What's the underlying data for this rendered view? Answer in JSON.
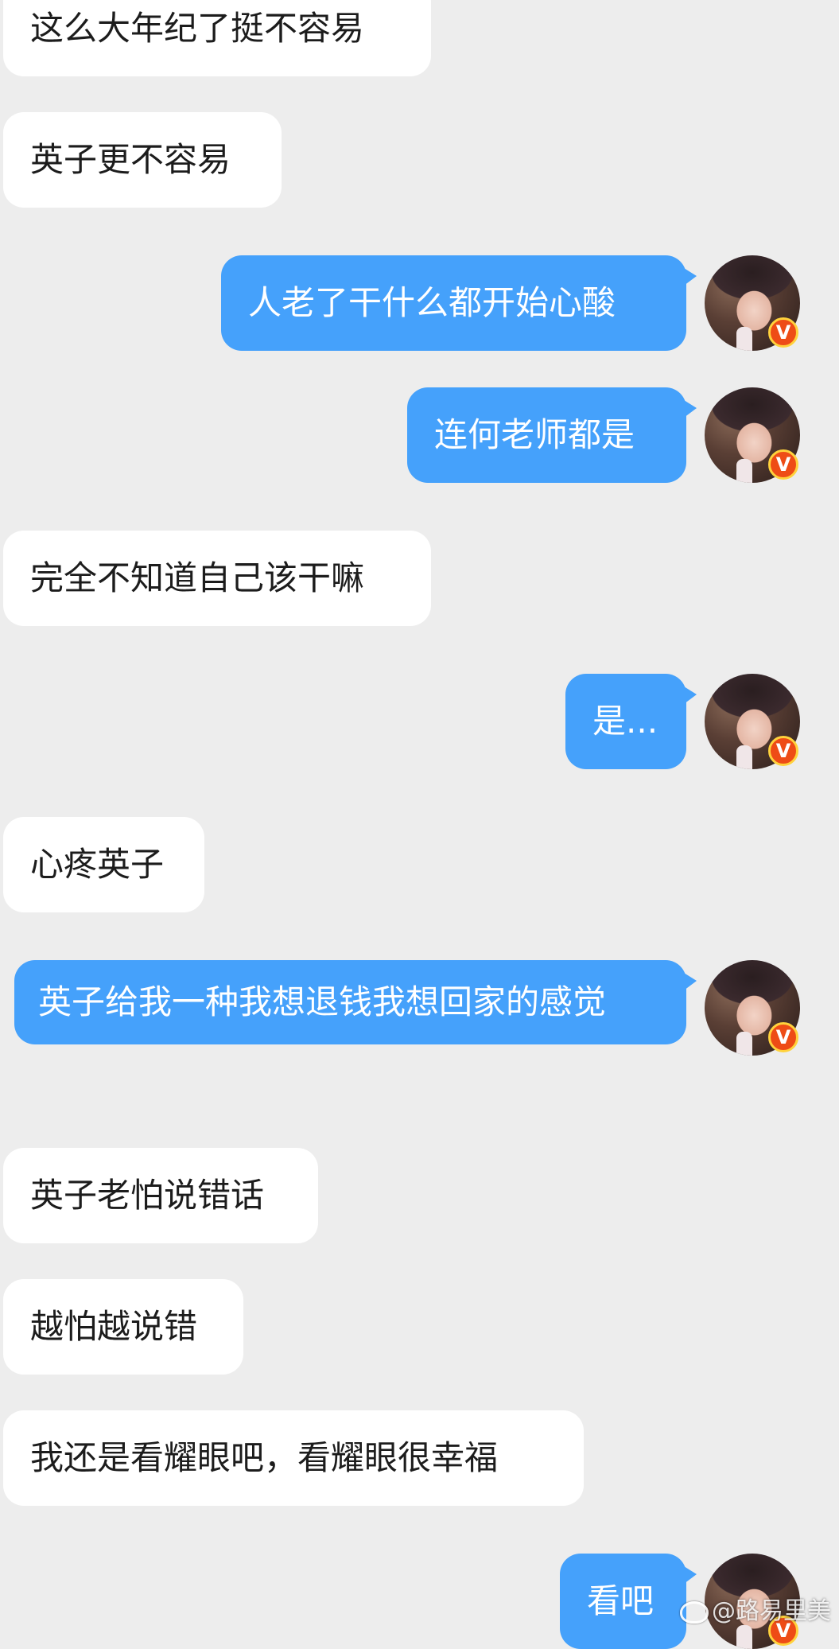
{
  "chat": {
    "messages": [
      {
        "side": "left",
        "text": "这么大年纪了挺不容易"
      },
      {
        "side": "left",
        "text": "英子更不容易"
      },
      {
        "side": "right",
        "text": "人老了干什么都开始心酸"
      },
      {
        "side": "right",
        "text": "连何老师都是"
      },
      {
        "side": "left",
        "text": "完全不知道自己该干嘛"
      },
      {
        "side": "right",
        "text": "是..."
      },
      {
        "side": "left",
        "text": "心疼英子"
      },
      {
        "side": "right",
        "text": "英子给我一种我想退钱我想回家的感觉"
      },
      {
        "side": "left",
        "text": "英子老怕说错话"
      },
      {
        "side": "left",
        "text": "越怕越说错"
      },
      {
        "side": "left",
        "text": "我还是看耀眼吧，看耀眼很幸福"
      },
      {
        "side": "right",
        "text": "看吧"
      }
    ],
    "verified_badge": "V"
  },
  "watermark": {
    "text": "@路易里美"
  },
  "colors": {
    "background": "#ededed",
    "incoming_bubble": "#ffffff",
    "outgoing_bubble": "#45a1fb",
    "badge": "#ee4c16"
  }
}
